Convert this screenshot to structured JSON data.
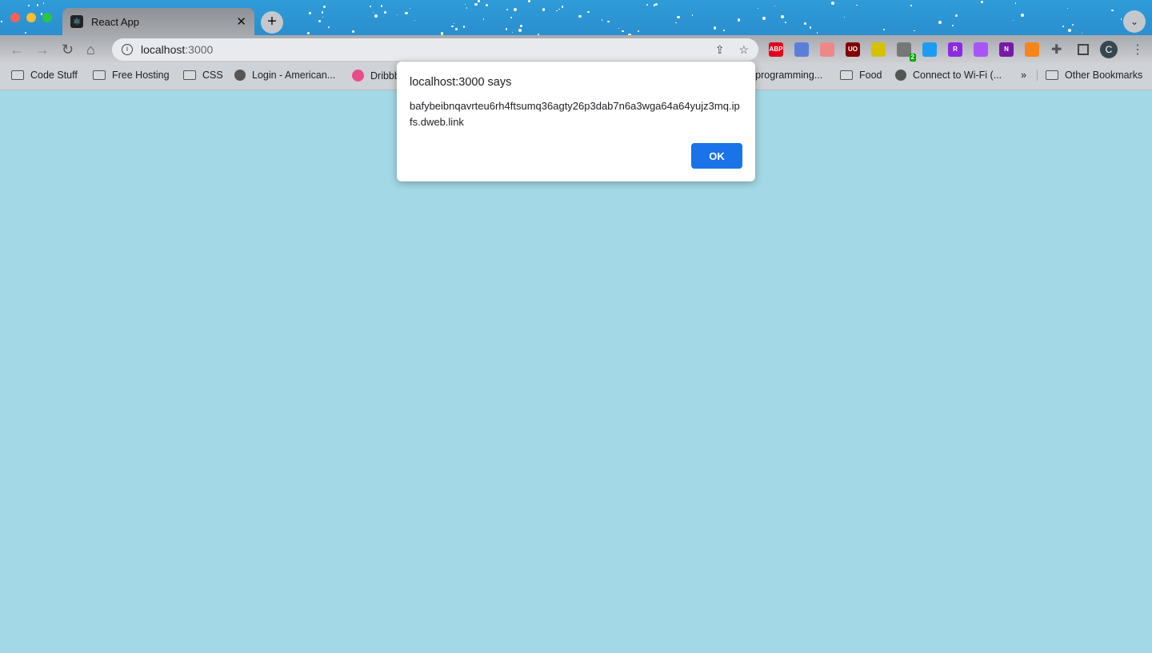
{
  "tab": {
    "title": "React App",
    "favicon": "react-icon"
  },
  "address": {
    "host": "localhost",
    "port": ":3000"
  },
  "bookmarks": [
    {
      "label": "Code Stuff",
      "icon": "folder"
    },
    {
      "label": "Free Hosting",
      "icon": "folder"
    },
    {
      "label": "CSS",
      "icon": "folder"
    },
    {
      "label": "Login - American...",
      "icon": "globe"
    },
    {
      "label": "Dribbble",
      "icon": "dribbble"
    },
    {
      "label": "-programming...",
      "icon": "folder"
    },
    {
      "label": "Food",
      "icon": "folder"
    },
    {
      "label": "Connect to Wi-Fi (...",
      "icon": "globe"
    },
    {
      "label": "»",
      "icon": "chevron"
    },
    {
      "label": "Other Bookmarks",
      "icon": "folder"
    }
  ],
  "extensions": [
    {
      "name": "adblock-plus",
      "label": "ABP",
      "color": "#e0001b"
    },
    {
      "name": "screenshot",
      "label": "",
      "color": "#5b7fd8"
    },
    {
      "name": "pig",
      "label": "",
      "color": "#e88"
    },
    {
      "name": "ublock",
      "label": "UO",
      "color": "#800000"
    },
    {
      "name": "lightning",
      "label": "",
      "color": "#d6c100"
    },
    {
      "name": "pulse",
      "label": "",
      "color": "#777",
      "badge": "2"
    },
    {
      "name": "window",
      "label": "",
      "color": "#1d9bf0"
    },
    {
      "name": "r-ext",
      "label": "R",
      "color": "#8a2be2"
    },
    {
      "name": "ring",
      "label": "",
      "color": "#a855f7"
    },
    {
      "name": "onenote",
      "label": "N",
      "color": "#7719aa"
    },
    {
      "name": "metamask",
      "label": "",
      "color": "#f6851b"
    }
  ],
  "profile": {
    "initial": "C"
  },
  "dialog": {
    "title": "localhost:3000 says",
    "message": "bafybeibnqavrteu6rh4ftsumq36agty26p3dab7n6a3wga64a64yujz3mq.ipfs.dweb.link",
    "ok_label": "OK"
  },
  "colors": {
    "page_bg": "#a3d9e6",
    "accent": "#1a73e8"
  }
}
